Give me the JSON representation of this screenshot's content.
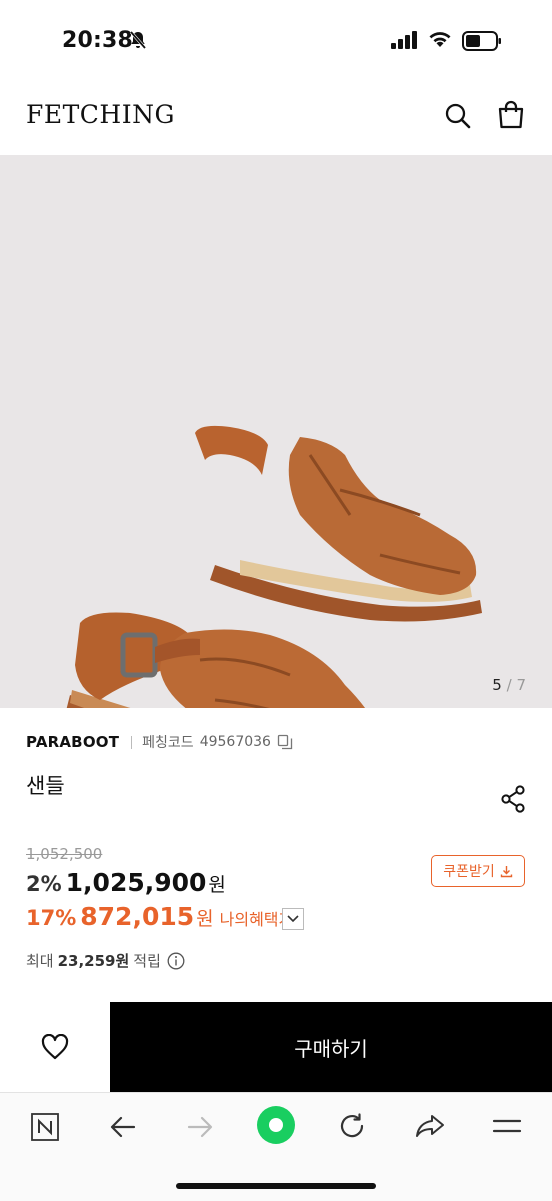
{
  "status_bar": {
    "time": "20:38"
  },
  "header": {
    "logo": "FETCHING"
  },
  "gallery": {
    "current": "5",
    "separator": "/",
    "total": "7"
  },
  "product": {
    "brand": "PARABOOT",
    "code_label": "페칭코드",
    "code": "49567036",
    "name": "샌들"
  },
  "pricing": {
    "original_price": "1,052,500",
    "discount_pct": "2%",
    "price": "1,025,900",
    "currency": "원",
    "benefit_pct": "17%",
    "benefit_price": "872,015",
    "benefit_label": "나의혜택가",
    "coupon_label": "쿠폰받기"
  },
  "points": {
    "prefix": "최대",
    "amount": "23,259원",
    "suffix": "적립"
  },
  "actions": {
    "buy_label": "구매하기"
  },
  "colors": {
    "accent": "#e8632b",
    "buy_bg": "#000000",
    "image_bg": "#e9e6e7"
  },
  "icons": {
    "header": [
      "search-icon",
      "shopping-bag-icon"
    ],
    "browser": [
      "naver-n-icon",
      "back-arrow-icon",
      "forward-arrow-icon",
      "green-home-icon",
      "refresh-icon",
      "share-arrow-icon",
      "menu-icon"
    ]
  }
}
